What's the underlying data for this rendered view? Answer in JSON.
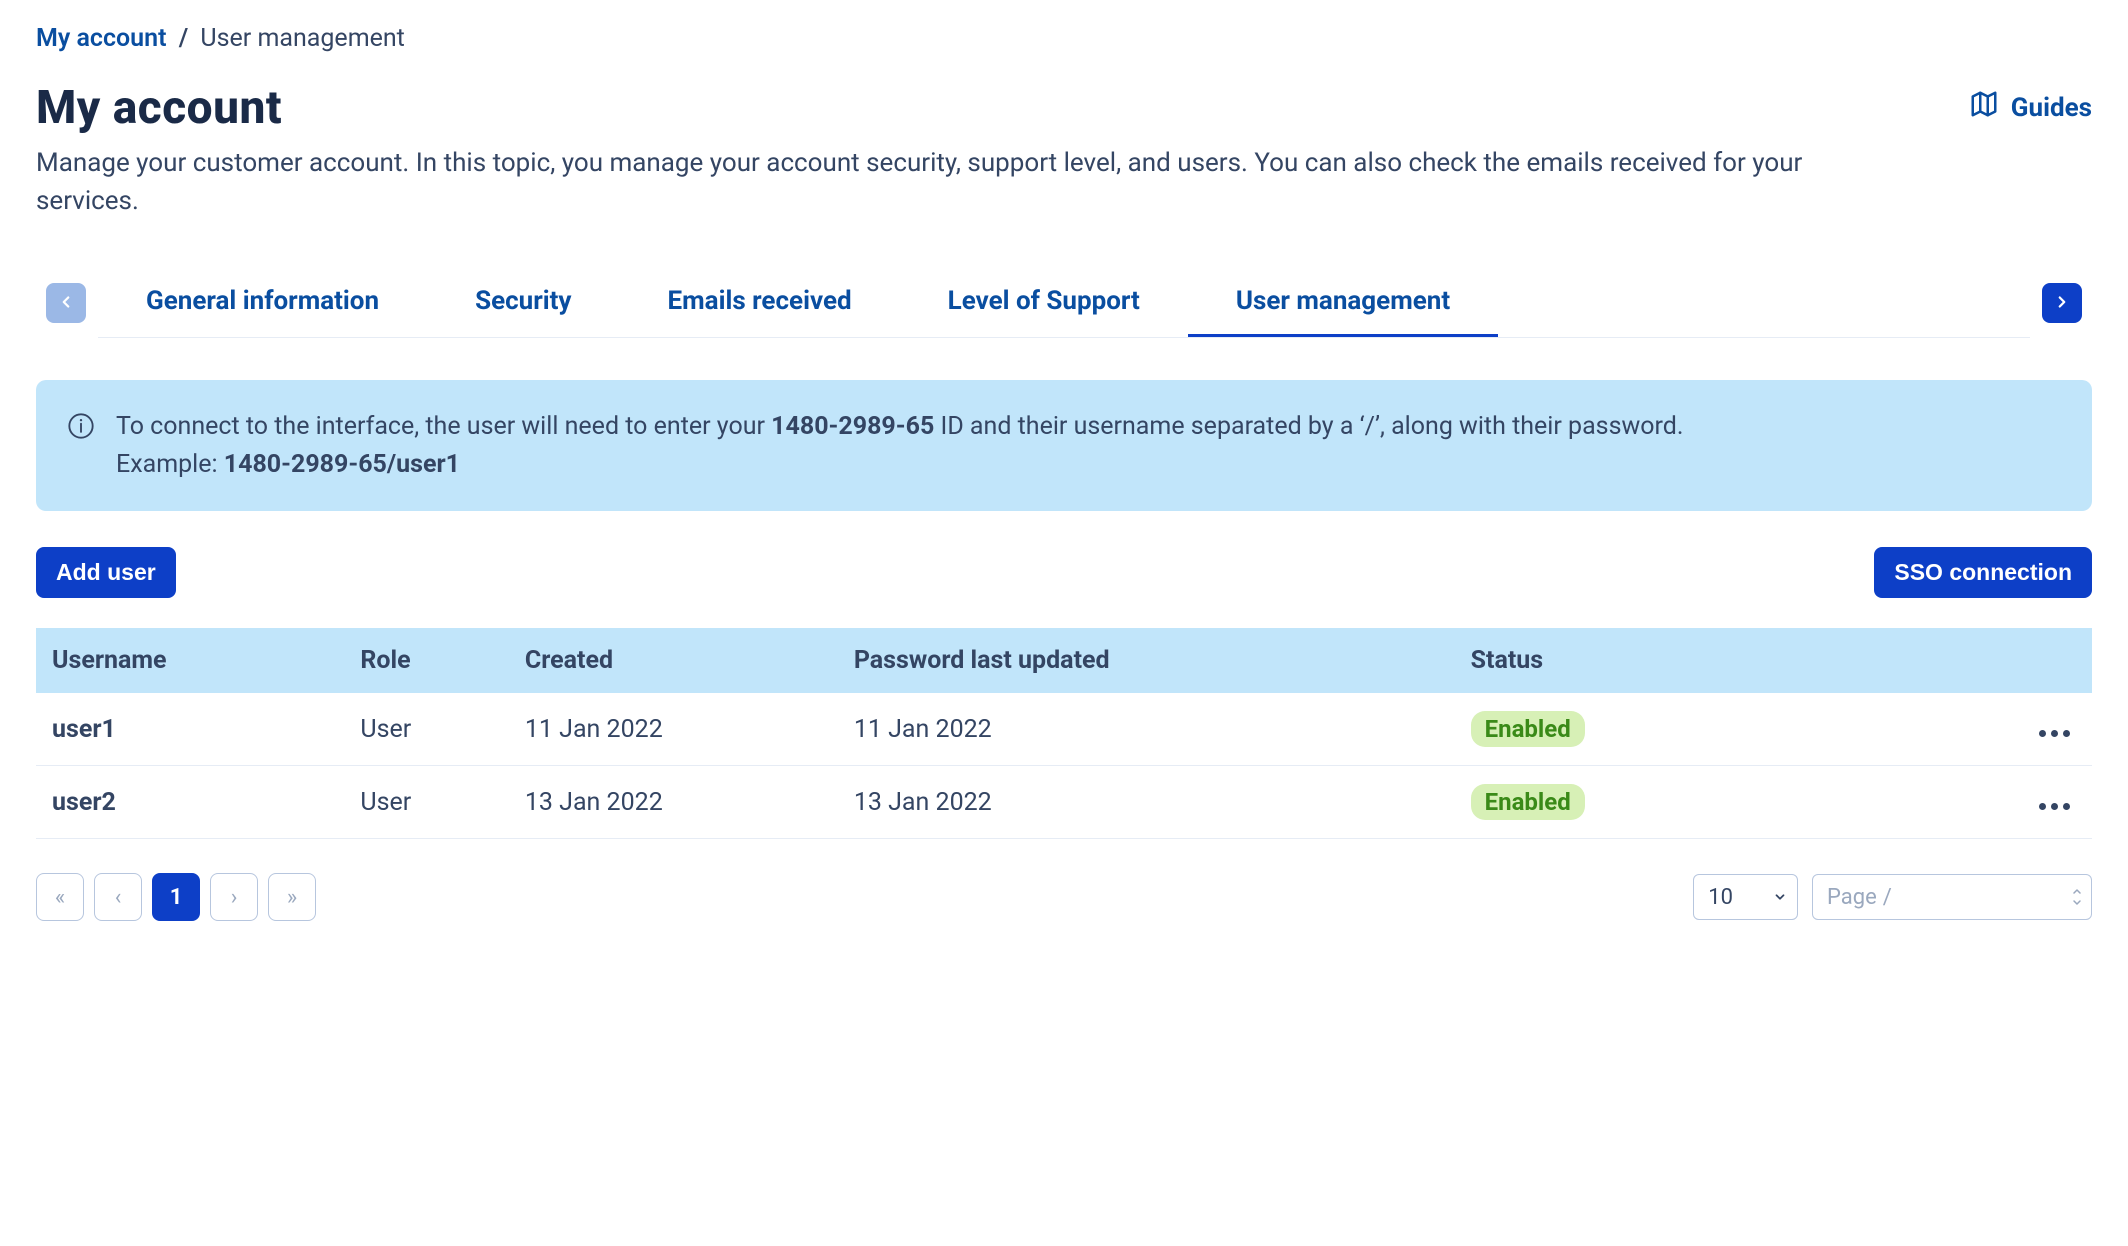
{
  "breadcrumb": {
    "root": "My account",
    "current": "User management",
    "sep": "/"
  },
  "header": {
    "title": "My account",
    "description": "Manage your customer account. In this topic, you manage your account security, support level, and users. You can also check the emails received for your services.",
    "guides_label": "Guides"
  },
  "tabs": [
    {
      "label": "General information",
      "active": false
    },
    {
      "label": "Security",
      "active": false
    },
    {
      "label": "Emails received",
      "active": false
    },
    {
      "label": "Level of Support",
      "active": false
    },
    {
      "label": "User management",
      "active": true
    }
  ],
  "info": {
    "text_pre": "To connect to the interface, the user will need to enter your ",
    "account_id": "1480-2989-65",
    "text_mid": " ID and their username separated by a ‘/’, along with their password.",
    "example_label": "Example: ",
    "example_value": "1480-2989-65/user1"
  },
  "actions": {
    "add_user": "Add user",
    "sso": "SSO connection"
  },
  "table": {
    "columns": {
      "username": "Username",
      "role": "Role",
      "created": "Created",
      "updated": "Password last updated",
      "status": "Status"
    },
    "rows": [
      {
        "username": "user1",
        "role": "User",
        "created": "11 Jan 2022",
        "updated": "11 Jan 2022",
        "status": "Enabled"
      },
      {
        "username": "user2",
        "role": "User",
        "created": "13 Jan 2022",
        "updated": "13 Jan 2022",
        "status": "Enabled"
      }
    ]
  },
  "pager": {
    "first": "«",
    "prev": "‹",
    "current": "1",
    "next": "›",
    "last": "»",
    "per_page": "10",
    "page_label": "Page",
    "page_sep": "/"
  }
}
